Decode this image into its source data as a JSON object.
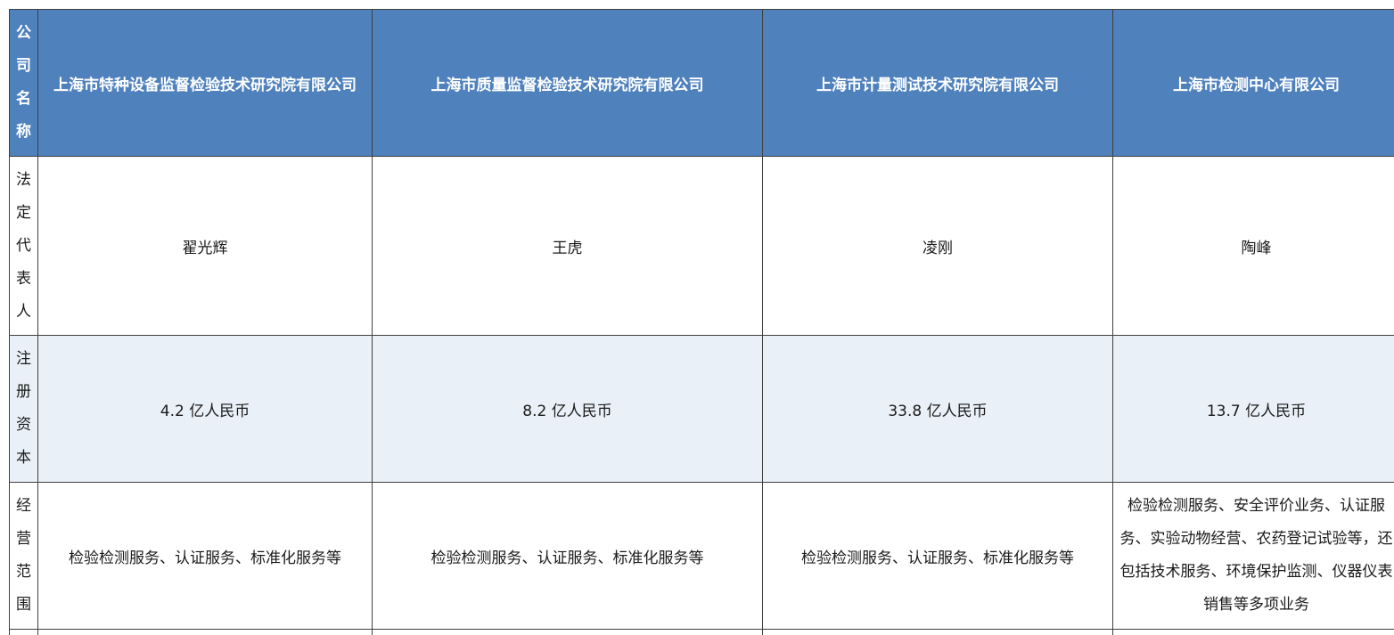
{
  "header": {
    "label": "公司名称",
    "companies": [
      "上海市特种设备监督检验技术研究院有限公司",
      "上海市质量监督检验技术研究院有限公司",
      "上海市计量测试技术研究院有限公司",
      "上海市检测中心有限公司"
    ]
  },
  "rows": {
    "representative": {
      "label": "法定代表人",
      "values": [
        "翟光辉",
        "王虎",
        "凌刚",
        "陶峰"
      ]
    },
    "capital": {
      "label": "注册资本",
      "values": [
        "4.2 亿人民币",
        "8.2 亿人民币",
        "33.8 亿人民币",
        "13.7 亿人民币"
      ]
    },
    "scope": {
      "label": "经营范围",
      "values": [
        "检验检测服务、认证服务、标准化服务等",
        "检验检测服务、认证服务、标准化服务等",
        "检验检测服务、认证服务、标准化服务等",
        "检验检测服务、安全评价业务、认证服务、实验动物经营、农药登记试验等，还包括技术服务、环境保护监测、仪器仪表销售等多项业务"
      ]
    }
  },
  "colors": {
    "header_bg": "#4f81bd",
    "header_text": "#ffffff",
    "band_bg": "#eaf0f7",
    "border": "#3f3f3f"
  }
}
